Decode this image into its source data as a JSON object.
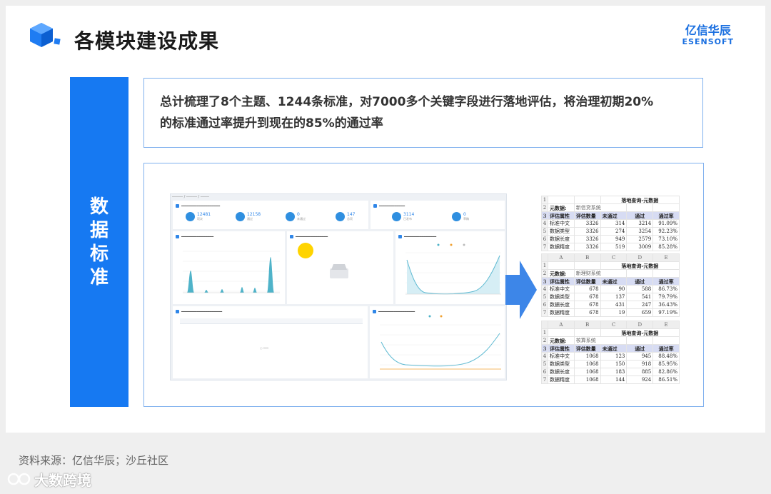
{
  "header": {
    "title": "各模块建设成果",
    "brand_cn": "亿信华辰",
    "brand_en": "ESENSOFT"
  },
  "sidebar": {
    "label_lines": [
      "数",
      "据",
      "标",
      "准"
    ]
  },
  "summary": {
    "line1": "总计梳理了8个主题、1244条标准，对7000多个关键字段进行落地评估，将治理初期20%",
    "line2": "的标准通过率提升到现在的85%的通过率"
  },
  "dashboard": {
    "stats": [
      {
        "value": "12481",
        "label": "项次"
      },
      {
        "value": "12158",
        "label": "通过"
      },
      {
        "value": "0",
        "label": "未通过"
      },
      {
        "value": "147",
        "label": "总项"
      }
    ],
    "stats2": [
      {
        "value": "3114",
        "label": "已发布"
      },
      {
        "value": "0",
        "label": "草稿"
      }
    ]
  },
  "sheets": [
    {
      "title": "落地查询-元数据",
      "system_label": "元数据:",
      "system_name": "新信贷系统",
      "col_headers": [],
      "headers": [
        "评估属性",
        "评估数量",
        "未通过",
        "通过",
        "通过率"
      ],
      "rows": [
        [
          "标准中文",
          "3326",
          "314",
          "3214",
          "91.09%"
        ],
        [
          "数据类型",
          "3326",
          "274",
          "3254",
          "92.23%"
        ],
        [
          "数据长度",
          "3326",
          "949",
          "2579",
          "73.10%"
        ],
        [
          "数据精度",
          "3326",
          "519",
          "3009",
          "85.28%"
        ]
      ]
    },
    {
      "title": "落地查询-元数据",
      "system_label": "元数据:",
      "system_name": "新理财系统",
      "col_headers": [
        "A",
        "B",
        "C",
        "D",
        "E"
      ],
      "headers": [
        "评估属性",
        "评估数量",
        "未通过",
        "通过",
        "通过率"
      ],
      "rows": [
        [
          "标准中文",
          "678",
          "90",
          "588",
          "86.73%"
        ],
        [
          "数据类型",
          "678",
          "137",
          "541",
          "79.79%"
        ],
        [
          "数据长度",
          "678",
          "431",
          "247",
          "36.43%"
        ],
        [
          "数据精度",
          "678",
          "19",
          "659",
          "97.19%"
        ]
      ]
    },
    {
      "title": "落地查询-元数据",
      "system_label": "元数据:",
      "system_name": "核算系统",
      "col_headers": [
        "A",
        "B",
        "C",
        "D",
        "E"
      ],
      "headers": [
        "评估属性",
        "评估数量",
        "未通过",
        "通过",
        "通过率"
      ],
      "rows": [
        [
          "标准中文",
          "1068",
          "123",
          "945",
          "88.48%"
        ],
        [
          "数据类型",
          "1068",
          "150",
          "918",
          "85.95%"
        ],
        [
          "数据长度",
          "1068",
          "183",
          "885",
          "82.86%"
        ],
        [
          "数据精度",
          "1068",
          "144",
          "924",
          "86.51%"
        ]
      ]
    }
  ],
  "footer": {
    "source": "资料来源：亿信华辰；沙丘社区",
    "watermark": "大数跨境"
  },
  "colors": {
    "accent": "#1679f2",
    "border": "#7fb0ee",
    "brand": "#1a6fe0",
    "sheet_header": "#d7dcf3"
  }
}
